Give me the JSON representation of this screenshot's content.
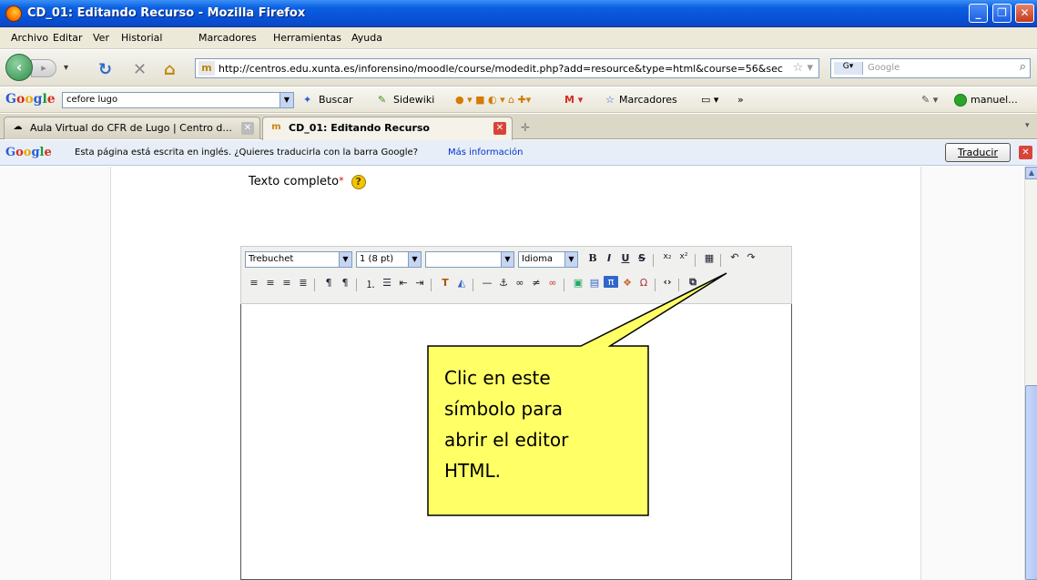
{
  "window": {
    "title": "CD_01: Editando Recurso - Mozilla Firefox",
    "controls": [
      "_",
      "❐",
      "✕"
    ]
  },
  "menu": [
    "Archivo",
    "Editar",
    "Ver",
    "Historial",
    "Marcadores",
    "Herramientas",
    "Ayuda"
  ],
  "nav": {
    "url": "http://centros.edu.xunta.es/inforensino/moodle/course/modedit.php?add=resource&type=html&course=56&sec",
    "search_placeholder": "Google"
  },
  "google_toolbar": {
    "query": "cefore lugo",
    "items": [
      "Buscar",
      "Sidewiki",
      "Marcadores",
      "»"
    ],
    "user": "manuel..."
  },
  "tabs": [
    {
      "label": "Aula Virtual do CFR de Lugo | Centro d...",
      "active": false
    },
    {
      "label": "CD_01: Editando Recurso",
      "active": true
    }
  ],
  "translate_bar": {
    "message": "Esta página está escrita en inglés. ¿Quieres traducirla con la barra Google?",
    "more_link": "Más información",
    "button": "Traducir"
  },
  "form": {
    "label": "Texto completo",
    "required_mark": "*",
    "help": "?"
  },
  "editor": {
    "font": "Trebuchet",
    "size": "1 (8 pt)",
    "format": "",
    "language": "Idioma"
  },
  "callout": {
    "lines": [
      "Clic en este",
      "símbolo para",
      "abrir el editor",
      "HTML."
    ],
    "fill": "#ffff66",
    "stroke": "#000000"
  }
}
